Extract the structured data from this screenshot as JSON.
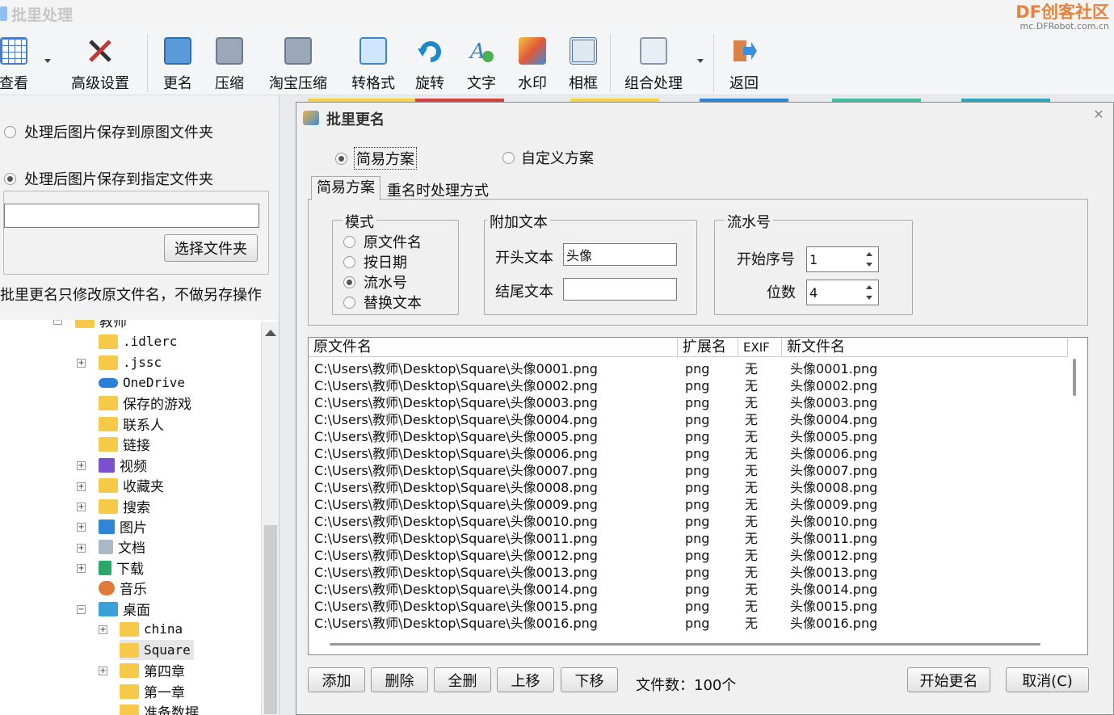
{
  "app": {
    "title": "批里处理"
  },
  "brand": {
    "line1": "DF创客社区",
    "line2": "mc.DFRobot.com.cn"
  },
  "toolbar": {
    "view": "查看",
    "advanced": "高级设置",
    "rename": "更名",
    "compress": "压缩",
    "taobao": "淘宝压缩",
    "convert": "转格式",
    "rotate": "旋转",
    "text": "文字",
    "watermark": "水印",
    "frame": "相框",
    "combine": "组合处理",
    "back": "返回"
  },
  "left_panel": {
    "opt_original": "处理后图片保存到原图文件夹",
    "opt_specified": "处理后图片保存到指定文件夹",
    "folder_value": "",
    "choose_button": "选择文件夹",
    "note": "批里更名只修改原文件名，不做另存操作"
  },
  "tree": {
    "root_partial": "教师",
    "items": [
      ".idlerc",
      ".jssc",
      "OneDrive",
      "保存的游戏",
      "联系人",
      "链接",
      "视频",
      "收藏夹",
      "搜索",
      "图片",
      "文档",
      "下载",
      "音乐",
      "桌面"
    ],
    "desktop_children": [
      "china",
      "Square",
      "第四章",
      "第一章",
      "准备数据"
    ]
  },
  "dialog": {
    "title": "批里更名",
    "radio_easy": "简易方案",
    "radio_custom": "自定义方案",
    "tab_easy": "简易方案",
    "tab_conflict": "重名时处理方式",
    "mode": {
      "legend": "模式",
      "options": [
        "原文件名",
        "按日期",
        "流水号",
        "替换文本"
      ],
      "selected": "流水号"
    },
    "append": {
      "legend": "附加文本",
      "start_label": "开头文本",
      "start_value": "头像",
      "end_label": "结尾文本",
      "end_value": ""
    },
    "serial": {
      "legend": "流水号",
      "start_label": "开始序号",
      "start_value": "1",
      "digits_label": "位数",
      "digits_value": "4"
    },
    "columns": [
      "原文件名",
      "扩展名",
      "EXIF",
      "新文件名"
    ],
    "rows": [
      [
        "C:\\Users\\教师\\Desktop\\Square\\头像0001.png",
        "png",
        "无",
        "头像0001.png"
      ],
      [
        "C:\\Users\\教师\\Desktop\\Square\\头像0002.png",
        "png",
        "无",
        "头像0002.png"
      ],
      [
        "C:\\Users\\教师\\Desktop\\Square\\头像0003.png",
        "png",
        "无",
        "头像0003.png"
      ],
      [
        "C:\\Users\\教师\\Desktop\\Square\\头像0004.png",
        "png",
        "无",
        "头像0004.png"
      ],
      [
        "C:\\Users\\教师\\Desktop\\Square\\头像0005.png",
        "png",
        "无",
        "头像0005.png"
      ],
      [
        "C:\\Users\\教师\\Desktop\\Square\\头像0006.png",
        "png",
        "无",
        "头像0006.png"
      ],
      [
        "C:\\Users\\教师\\Desktop\\Square\\头像0007.png",
        "png",
        "无",
        "头像0007.png"
      ],
      [
        "C:\\Users\\教师\\Desktop\\Square\\头像0008.png",
        "png",
        "无",
        "头像0008.png"
      ],
      [
        "C:\\Users\\教师\\Desktop\\Square\\头像0009.png",
        "png",
        "无",
        "头像0009.png"
      ],
      [
        "C:\\Users\\教师\\Desktop\\Square\\头像0010.png",
        "png",
        "无",
        "头像0010.png"
      ],
      [
        "C:\\Users\\教师\\Desktop\\Square\\头像0011.png",
        "png",
        "无",
        "头像0011.png"
      ],
      [
        "C:\\Users\\教师\\Desktop\\Square\\头像0012.png",
        "png",
        "无",
        "头像0012.png"
      ],
      [
        "C:\\Users\\教师\\Desktop\\Square\\头像0013.png",
        "png",
        "无",
        "头像0013.png"
      ],
      [
        "C:\\Users\\教师\\Desktop\\Square\\头像0014.png",
        "png",
        "无",
        "头像0014.png"
      ],
      [
        "C:\\Users\\教师\\Desktop\\Square\\头像0015.png",
        "png",
        "无",
        "头像0015.png"
      ],
      [
        "C:\\Users\\教师\\Desktop\\Square\\头像0016.png",
        "png",
        "无",
        "头像0016.png"
      ]
    ],
    "buttons": {
      "add": "添加",
      "delete": "删除",
      "delete_all": "全删",
      "move_up": "上移",
      "move_down": "下移",
      "start": "开始更名",
      "cancel": "取消(C)"
    },
    "file_count": "文件数：100个"
  }
}
